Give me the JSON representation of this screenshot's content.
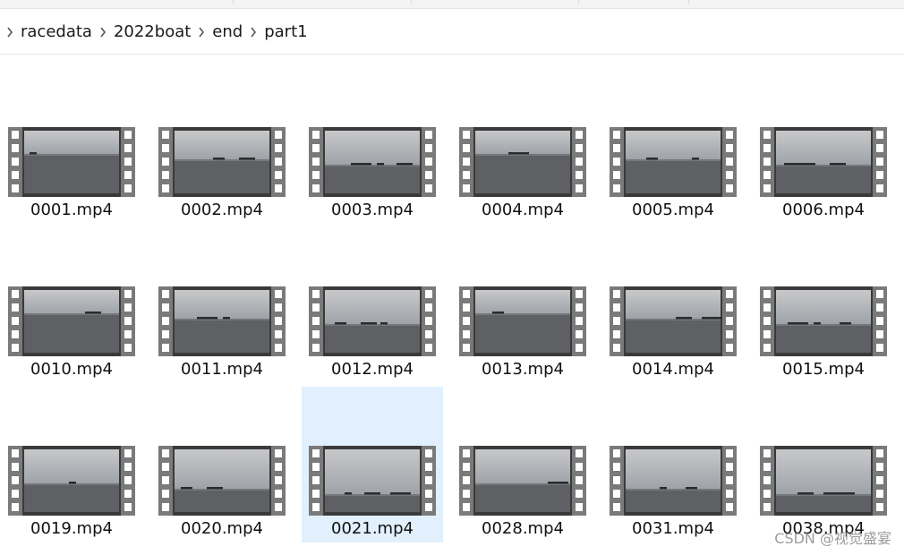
{
  "breadcrumb": [
    {
      "label": "racedata"
    },
    {
      "label": "2022boat"
    },
    {
      "label": "end"
    },
    {
      "label": "part1"
    }
  ],
  "files": [
    {
      "name": "0001.mp4"
    },
    {
      "name": "0002.mp4"
    },
    {
      "name": "0003.mp4"
    },
    {
      "name": "0004.mp4"
    },
    {
      "name": "0005.mp4"
    },
    {
      "name": "0006.mp4"
    },
    {
      "name": "0010.mp4"
    },
    {
      "name": "0011.mp4"
    },
    {
      "name": "0012.mp4"
    },
    {
      "name": "0013.mp4"
    },
    {
      "name": "0014.mp4"
    },
    {
      "name": "0015.mp4"
    },
    {
      "name": "0019.mp4"
    },
    {
      "name": "0020.mp4"
    },
    {
      "name": "0021.mp4",
      "selected": true
    },
    {
      "name": "0028.mp4"
    },
    {
      "name": "0031.mp4"
    },
    {
      "name": "0038.mp4"
    }
  ],
  "colors": {
    "selection": "#e1f0fc",
    "filmstrip": "#7a7a7a",
    "sky": "#b9bcc0",
    "sea": "#5e6064"
  },
  "icons": {
    "breadcrumb_separator": "chevron-right-icon",
    "file_thumbnail": "video-filmstrip-icon"
  },
  "watermark": "CSDN @视觉盛宴"
}
